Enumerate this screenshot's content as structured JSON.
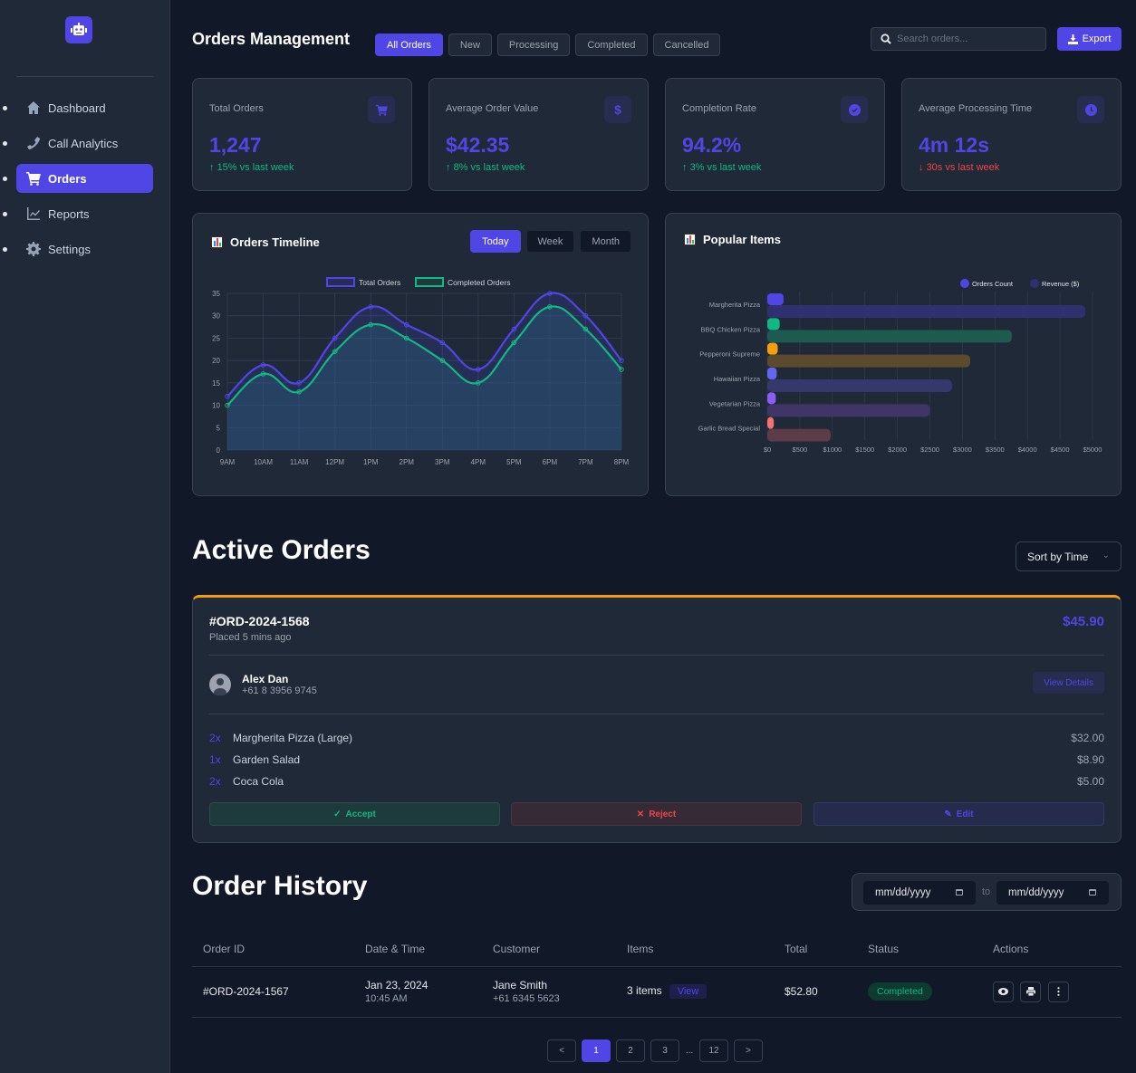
{
  "sidebar": {
    "logo_icon": "robot-icon",
    "items": [
      {
        "label": "Dashboard",
        "icon": "home-icon",
        "active": false
      },
      {
        "label": "Call Analytics",
        "icon": "phone-icon",
        "active": false
      },
      {
        "label": "Orders",
        "icon": "cart-icon",
        "active": true
      },
      {
        "label": "Reports",
        "icon": "chart-line-icon",
        "active": false
      },
      {
        "label": "Settings",
        "icon": "gear-icon",
        "active": false
      }
    ]
  },
  "header": {
    "title": "Orders Management",
    "filters": [
      "All Orders",
      "New",
      "Processing",
      "Completed",
      "Cancelled"
    ],
    "active_filter": "All Orders",
    "search_placeholder": "Search orders...",
    "export_label": "Export"
  },
  "stats": [
    {
      "label": "Total Orders",
      "value": "1,247",
      "change": "15% vs last week",
      "direction": "up",
      "icon": "cart-icon"
    },
    {
      "label": "Average Order Value",
      "value": "$42.35",
      "change": "8% vs last week",
      "direction": "up",
      "icon": "dollar-icon"
    },
    {
      "label": "Completion Rate",
      "value": "94.2%",
      "change": "3% vs last week",
      "direction": "up",
      "icon": "check-circle-icon"
    },
    {
      "label": "Average Processing Time",
      "value": "4m 12s",
      "change": "30s vs last week",
      "direction": "down",
      "icon": "clock-icon"
    }
  ],
  "timeline": {
    "title": "Orders Timeline",
    "ranges": [
      "Today",
      "Week",
      "Month"
    ],
    "active_range": "Today"
  },
  "popular": {
    "title": "Popular Items"
  },
  "chart_data": [
    {
      "type": "line",
      "title": "Orders Timeline",
      "x": [
        "9AM",
        "10AM",
        "11AM",
        "12PM",
        "1PM",
        "2PM",
        "3PM",
        "4PM",
        "5PM",
        "6PM",
        "7PM",
        "8PM"
      ],
      "series": [
        {
          "name": "Total Orders",
          "color": "#4f46e5",
          "values": [
            12,
            19,
            15,
            25,
            32,
            28,
            24,
            18,
            27,
            35,
            30,
            20
          ]
        },
        {
          "name": "Completed Orders",
          "color": "#10b981",
          "values": [
            10,
            17,
            13,
            22,
            28,
            25,
            20,
            15,
            24,
            32,
            27,
            18
          ]
        }
      ],
      "ylim": [
        0,
        35
      ],
      "yticks": [
        0,
        5,
        10,
        15,
        20,
        25,
        30,
        35
      ],
      "grid": true,
      "legend": "top"
    },
    {
      "type": "bar",
      "orientation": "horizontal",
      "title": "Popular Items",
      "categories": [
        "Margherita Pizza",
        "BBQ Chicken Pizza",
        "Pepperoni Supreme",
        "Hawaiian Pizza",
        "Vegetarian Pizza",
        "Garlic Bread Special"
      ],
      "series": [
        {
          "name": "Orders Count",
          "values": [
            250,
            190,
            160,
            145,
            130,
            100
          ],
          "colors": [
            "#4f46e5",
            "#10b981",
            "#f59e0b",
            "#6366f1",
            "#8b5cf6",
            "#f87171"
          ]
        },
        {
          "name": "Revenue ($)",
          "values": [
            4890,
            3760,
            3120,
            2840,
            2500,
            975
          ],
          "colors": [
            "#2e3070",
            "#1d5b50",
            "#5b4b2c",
            "#34386b",
            "#3f3566",
            "#5b3c47"
          ]
        }
      ],
      "legend_colors": [
        "#4f46e5",
        "#2e3070"
      ],
      "xlim": [
        0,
        5000
      ],
      "xticks": [
        "$0",
        "$500",
        "$1000",
        "$1500",
        "$2000",
        "$2500",
        "$3000",
        "$3500",
        "$4000",
        "$4500",
        "$5000"
      ],
      "grid": true,
      "legend": "top-right"
    }
  ],
  "active_orders": {
    "title": "Active Orders",
    "sort_label": "Sort by Time",
    "order": {
      "id": "#ORD-2024-1568",
      "placed": "Placed 5 mins ago",
      "total": "$45.90",
      "customer_name": "Alex Dan",
      "customer_phone": "+61 8 3956 9745",
      "view_details": "View Details",
      "items": [
        {
          "qty": "2x",
          "name": "Margherita Pizza (Large)",
          "price": "$32.00"
        },
        {
          "qty": "1x",
          "name": "Garden Salad",
          "price": "$8.90"
        },
        {
          "qty": "2x",
          "name": "Coca Cola",
          "price": "$5.00"
        }
      ],
      "accept": "Accept",
      "reject": "Reject",
      "edit": "Edit",
      "accent_color": "#f59e0b"
    }
  },
  "history": {
    "title": "Order History",
    "date_from_placeholder": "mm/dd/yyyy",
    "date_to_placeholder": "mm/dd/yyyy",
    "to_label": "to",
    "columns": [
      "Order ID",
      "Date & Time",
      "Customer",
      "Items",
      "Total",
      "Status",
      "Actions"
    ],
    "rows": [
      {
        "id": "#ORD-2024-1567",
        "date": "Jan 23, 2024",
        "time": "10:45 AM",
        "customer": "Jane Smith",
        "phone": "+61 6345 5623",
        "items": "3 items",
        "view": "View",
        "total": "$52.80",
        "status": "Completed"
      }
    ],
    "pagination": {
      "pages": [
        "1",
        "2",
        "3"
      ],
      "ellipsis": "...",
      "last": "12",
      "current": "1"
    }
  }
}
